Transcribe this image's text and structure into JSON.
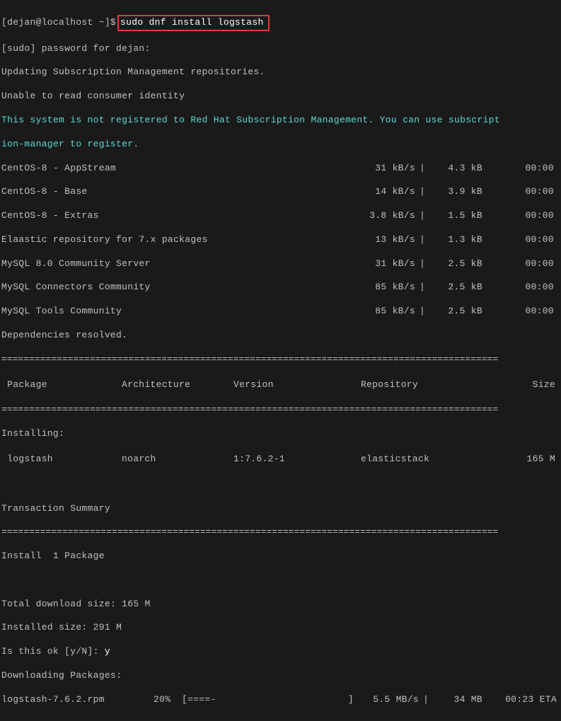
{
  "prompt": {
    "prefix": "[dejan@localhost ~]$",
    "command": "sudo dnf install logstash"
  },
  "lines": {
    "pw": "[sudo] password for dejan:",
    "upd": "Updating Subscription Management repositories.",
    "unable": "Unable to read consumer identity",
    "notreg1": "This system is not registered to Red Hat Subscription Management. You can use subscript",
    "notreg2": "ion-manager to register.",
    "depres": "Dependencies resolved.",
    "installing": "Installing:",
    "txnsum": "Transaction Summary",
    "install1pkg": "Install  1 Package",
    "tdsize": "Total download size: 165 M",
    "insize": "Installed size: 291 M",
    "isok": "Is this ok [y/N]: ",
    "isok_ans": "y",
    "dlpkg": "Downloading Packages:"
  },
  "repos": [
    {
      "name": "CentOS-8 - AppStream",
      "speed": "31 kB/s",
      "size": "4.3 kB",
      "time": "00:00"
    },
    {
      "name": "CentOS-8 - Base",
      "speed": "14 kB/s",
      "size": "3.9 kB",
      "time": "00:00"
    },
    {
      "name": "CentOS-8 - Extras",
      "speed": "3.8 kB/s",
      "size": "1.5 kB",
      "time": "00:00"
    },
    {
      "name": "Elaastic repository for 7.x packages",
      "speed": "13 kB/s",
      "size": "1.3 kB",
      "time": "00:00"
    },
    {
      "name": "MySQL 8.0 Community Server",
      "speed": "31 kB/s",
      "size": "2.5 kB",
      "time": "00:00"
    },
    {
      "name": "MySQL Connectors Community",
      "speed": "85 kB/s",
      "size": "2.5 kB",
      "time": "00:00"
    },
    {
      "name": "MySQL Tools Community",
      "speed": "85 kB/s",
      "size": "2.5 kB",
      "time": "00:00"
    }
  ],
  "headers": {
    "pkg": " Package",
    "arch": "Architecture",
    "ver": "Version",
    "repo": "Repository",
    "size": "Size"
  },
  "pkgrow": {
    "pkg": " logstash",
    "arch": "noarch",
    "ver": "1:7.6.2-1",
    "repo": "elasticstack",
    "size": "165 M"
  },
  "rule": "==========================================================================================",
  "progress": {
    "name": "logstash-7.6.2.rpm",
    "pct": "20%",
    "bar": "[====-                       ]",
    "speed": "5.5 MB/s",
    "size": "34 MB",
    "eta": "00:23 ETA"
  }
}
